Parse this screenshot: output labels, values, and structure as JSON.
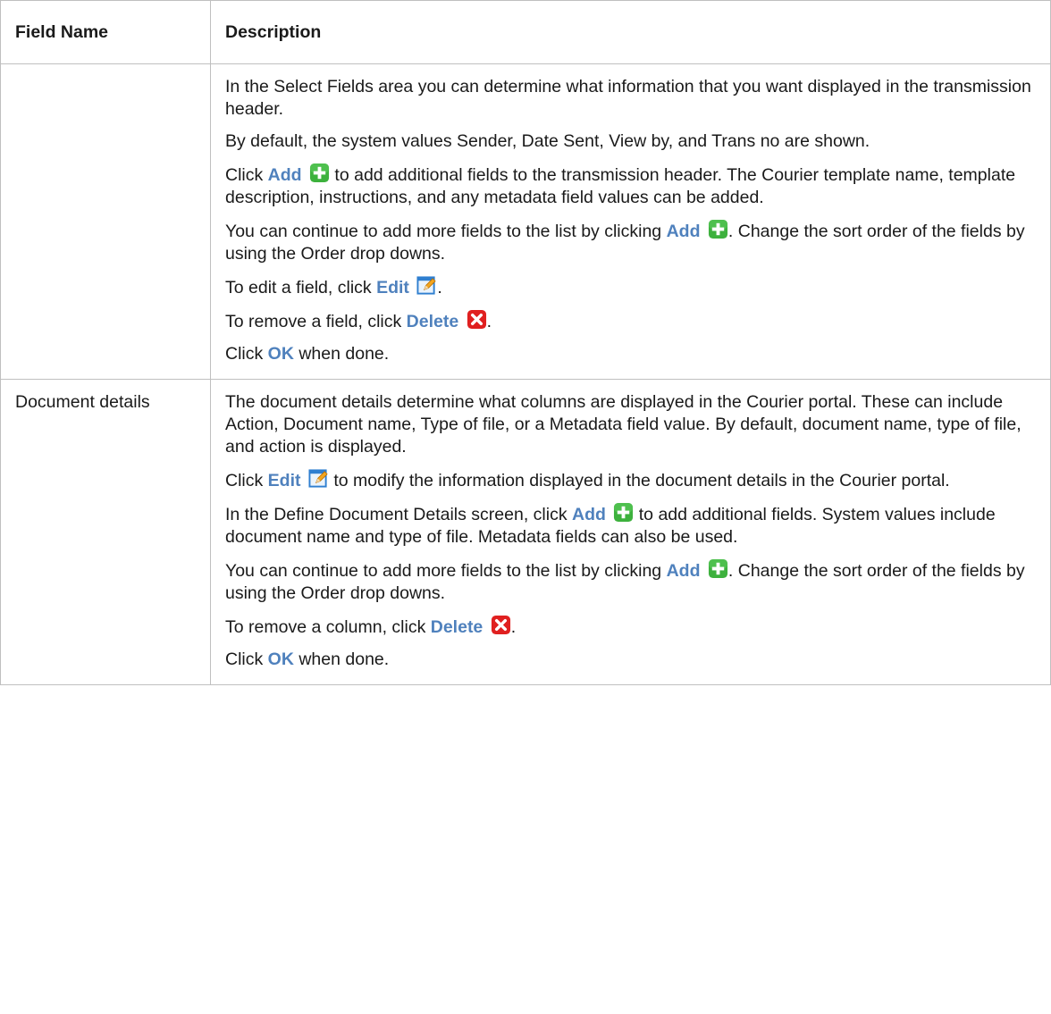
{
  "table": {
    "headers": {
      "field_name": "Field Name",
      "description": "Description"
    },
    "rows": [
      {
        "name": "",
        "paragraphs": [
          {
            "text": "In the Select Fields area you can determine what information that you want displayed in the transmission header."
          },
          {
            "text": "By default, the system values Sender, Date Sent, View by, and Trans no are shown."
          },
          {
            "before": "Click ",
            "keyword": "Add",
            "icon": "add-icon",
            "after": " to add additional fields to the transmission header. The Courier template name, template description, instructions, and any metadata field values can be added."
          },
          {
            "before": "You can continue to add more fields to the list by clicking ",
            "keyword": "Add",
            "icon": "add-icon",
            "after": ". Change the sort order of the fields by using the Order drop downs."
          },
          {
            "before": "To edit a field, click ",
            "keyword": "Edit",
            "icon": "edit-icon",
            "after": "."
          },
          {
            "before": "To remove a field, click ",
            "keyword": "Delete",
            "icon": "delete-icon",
            "after": "."
          },
          {
            "before": "Click ",
            "keyword": "OK",
            "after": " when done."
          }
        ]
      },
      {
        "name": "Document details",
        "paragraphs": [
          {
            "text": "The document details determine what columns are displayed in the Courier portal. These can include Action, Document name, Type of file, or a Metadata field value. By default, document name, type of file, and action is displayed."
          },
          {
            "before": "Click ",
            "keyword": "Edit",
            "icon": "edit-icon",
            "after": " to modify the information displayed in the document details in the Courier portal."
          },
          {
            "before": "In the Define Document Details screen, click ",
            "keyword": "Add",
            "icon": "add-icon",
            "after": " to add additional fields. System values include document name and type of file. Metadata fields can also be used."
          },
          {
            "before": "You can continue to add more fields to the list by clicking ",
            "keyword": "Add",
            "icon": "add-icon",
            "after": ". Change the sort order of the fields by using the Order drop downs."
          },
          {
            "before": "To remove a column, click ",
            "keyword": "Delete",
            "icon": "delete-icon",
            "after": "."
          },
          {
            "before": "Click ",
            "keyword": "OK",
            "after": " when done."
          }
        ]
      }
    ]
  },
  "colors": {
    "keyword": "#4f81bd",
    "add_icon": "#3db13d",
    "delete_icon": "#e02020",
    "edit_icon": "#2f7fd0",
    "border": "#bfbfbf"
  }
}
